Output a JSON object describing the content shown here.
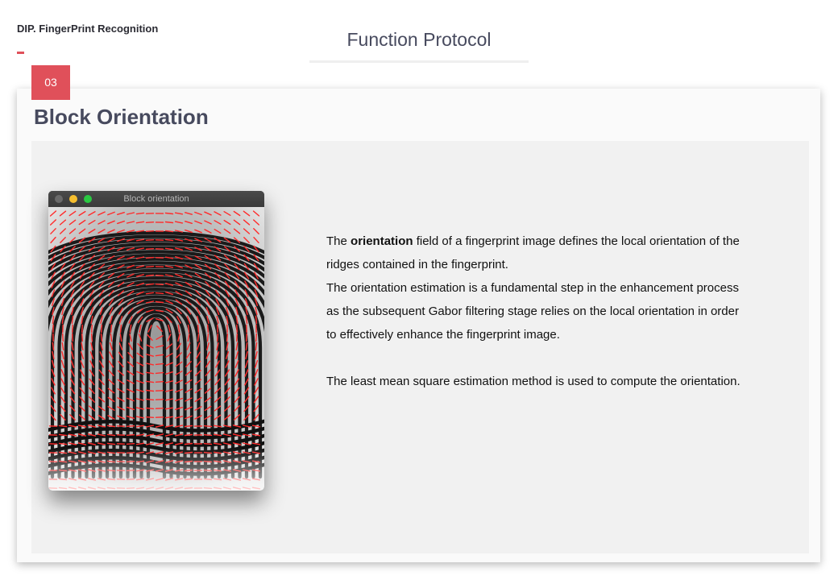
{
  "header": {
    "brand": "DIP. FingerPrint Recognition",
    "protocol_title": "Function Protocol"
  },
  "slide": {
    "number": "03",
    "title": "Block Orientation"
  },
  "window": {
    "title": "Block orientation"
  },
  "description": {
    "p1_before": "The",
    "p1_bold": "orientation",
    "p1_after": "field of a fingerprint image defines the local orientation of the ridges contained in the fingerprint.",
    "p2": "The orientation estimation is a fundamental step in the enhancement process as the subsequent Gabor filtering stage relies on the local orientation in order to effectively enhance the fingerprint image.",
    "p3": "The least mean square estimation method is used to compute the orientation."
  },
  "colors": {
    "accent": "#e0505a",
    "title_gray": "#474a5e",
    "orientation_marks": "#ff2a2a"
  }
}
